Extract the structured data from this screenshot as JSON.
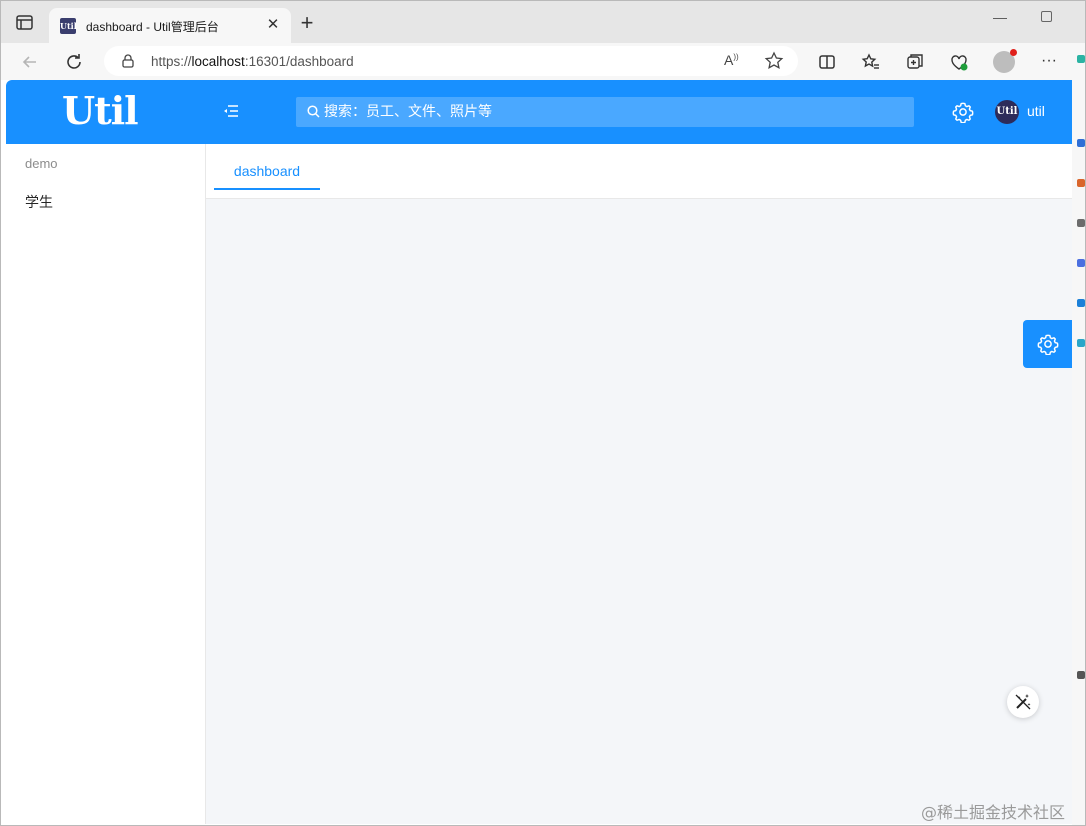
{
  "browser": {
    "tab_title": "dashboard - Util管理后台",
    "favicon_text": "Util",
    "url_prefix": "https://",
    "url_host": "localhost",
    "url_rest": ":16301/dashboard"
  },
  "header": {
    "logo": "Util",
    "search_placeholder": "搜索：员工、文件、照片等",
    "avatar_text": "Util",
    "user_name": "util"
  },
  "sidebar": {
    "group_title": "demo",
    "items": [
      {
        "label": "学生"
      }
    ]
  },
  "tabs": [
    {
      "label": "dashboard",
      "active": true
    }
  ],
  "watermark": "@稀土掘金技术社区",
  "colors": {
    "primary": "#1890ff",
    "content_bg": "#f4f6f9"
  }
}
